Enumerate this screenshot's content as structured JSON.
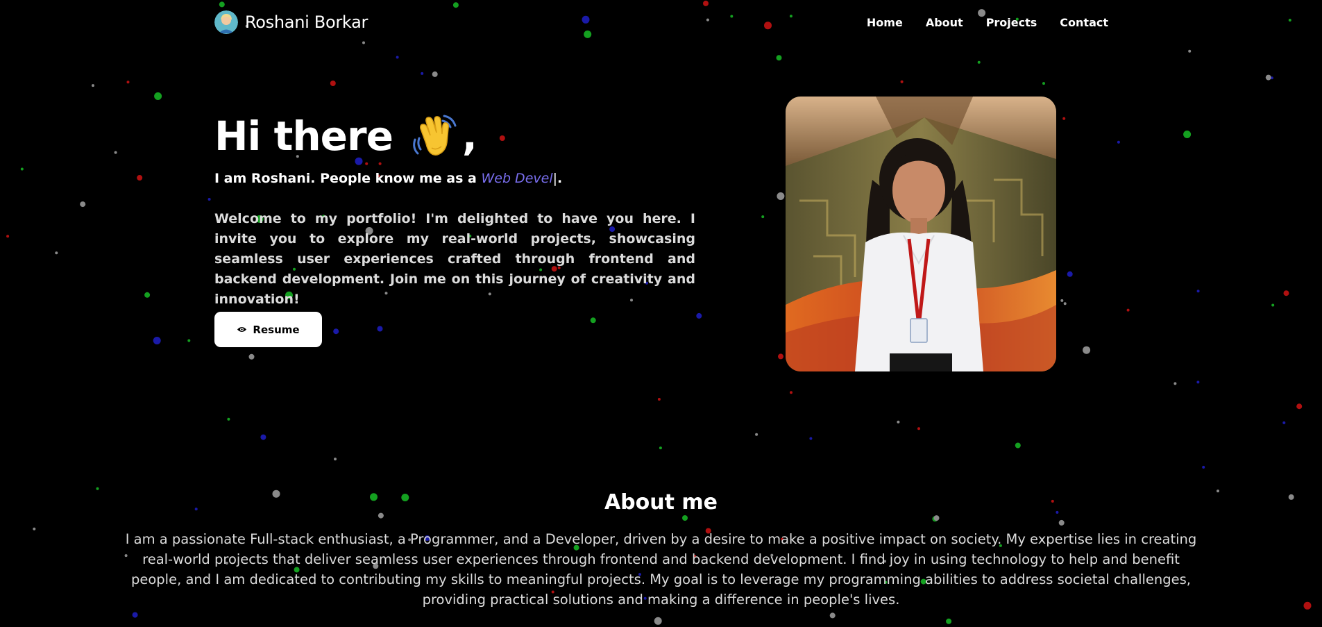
{
  "nav": {
    "brand_name": "Roshani Borkar",
    "links": [
      "Home",
      "About",
      "Projects",
      "Contact"
    ]
  },
  "hero": {
    "title": "Hi there",
    "title_suffix": ",",
    "subtitle_prefix": "I am Roshani. People know me as a ",
    "typed_text": "Web Devel",
    "cursor": "|",
    "subtitle_suffix": ".",
    "description": "Welcome to my portfolio! I'm delighted to have you here. I invite you to explore my real-world projects, showcasing seamless user experiences crafted through frontend and backend development. Join me on this journey of creativity and innovation!",
    "resume_label": "Resume"
  },
  "about": {
    "title": "About me",
    "text": "I am a passionate Full-stack enthusiast, a Programmer, and a Developer, driven by a desire to make a positive impact on society. My expertise lies in creating real-world projects that deliver seamless user experiences through frontend and backend development. I find joy in using technology to help and benefit people, and I am dedicated to contributing my skills to meaningful projects. My goal is to leverage my programming abilities to address societal challenges, providing practical solutions and making a difference in people's lives."
  },
  "icons": {
    "avatar": "avatar-icon",
    "wave": "waving-hand-icon",
    "resume": "eye-icon"
  },
  "colors": {
    "background": "#000000",
    "typed_accent": "#7a6ff0",
    "particle_red": "#b01010",
    "particle_green": "#14a020",
    "particle_blue": "#1a1aa8",
    "particle_gray": "#8a8a8a"
  }
}
